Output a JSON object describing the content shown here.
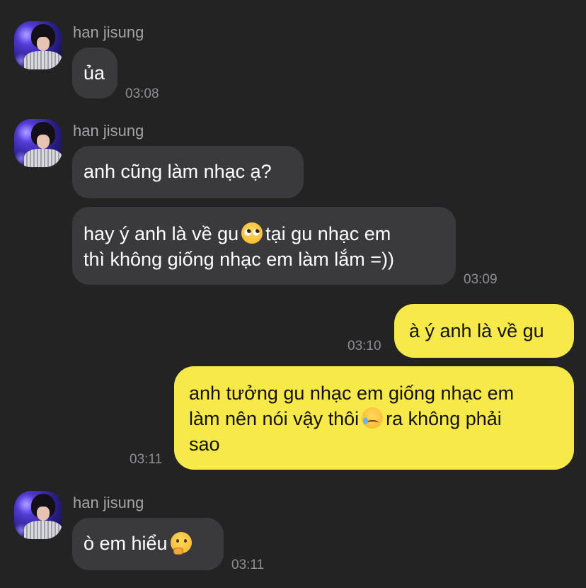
{
  "messages": [
    {
      "type": "incoming",
      "sender": "han jisung",
      "bubbles": [
        {
          "text": "ủa"
        }
      ],
      "time": "03:08"
    },
    {
      "type": "incoming",
      "sender": "han jisung",
      "bubbles": [
        {
          "text": "anh cũng làm nhạc ạ?"
        },
        {
          "text_before_emoji": "hay ý anh là về gu",
          "emoji": "pleading-face-icon",
          "text_after_emoji_line1": "tại gu nhạc em",
          "text_line2": "thì không giống nhạc em làm lắm =))"
        }
      ],
      "time": "03:09"
    },
    {
      "type": "outgoing",
      "bubbles": [
        {
          "text": "à ý anh là về gu"
        }
      ],
      "time": "03:10"
    },
    {
      "type": "outgoing",
      "bubbles": [
        {
          "line1": "anh tưởng gu nhạc em giống nhạc em",
          "line2_before_emoji": "làm nên nói vậy thôi",
          "emoji": "smiling-face-with-tear-icon",
          "line2_after_emoji": "ra không phải",
          "line3": "sao"
        }
      ],
      "time": "03:11"
    },
    {
      "type": "incoming",
      "sender": "han jisung",
      "bubbles": [
        {
          "text_before_emoji": "ò em hiểu",
          "emoji": "thinking-face-icon"
        }
      ],
      "time": "03:11"
    }
  ],
  "colors": {
    "background": "#232324",
    "incoming_bubble": "#3a3a3c",
    "outgoing_bubble": "#f7e94a",
    "sender_name": "#a3a3a6",
    "timestamp": "#8e8e92"
  }
}
